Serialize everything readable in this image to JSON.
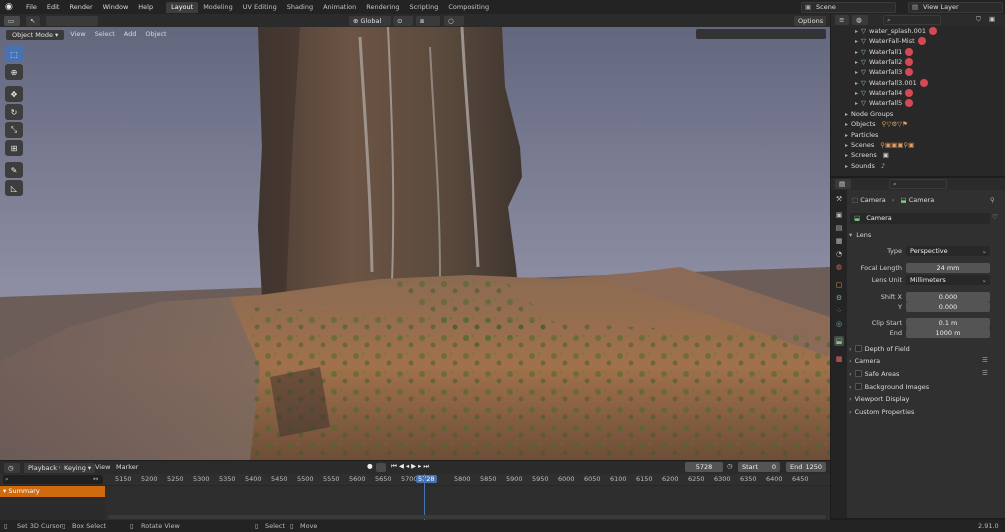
{
  "topbar": {
    "menus": [
      "File",
      "Edit",
      "Render",
      "Window",
      "Help"
    ],
    "workspaces": [
      "Layout",
      "Modeling",
      "UV Editing",
      "Shading",
      "Animation",
      "Rendering",
      "Scripting",
      "Compositing"
    ],
    "active_workspace": "Layout",
    "scene": "Scene",
    "view_layer": "View Layer"
  },
  "viewport_header": {
    "mode": "Object Mode",
    "menus": [
      "View",
      "Select",
      "Add",
      "Object"
    ],
    "orientation": "Global",
    "options": "Options"
  },
  "outliner": {
    "items": [
      {
        "name": "water_splash.001",
        "indent": 1
      },
      {
        "name": "WaterFall-Mist",
        "indent": 1
      },
      {
        "name": "Waterfall1",
        "indent": 1
      },
      {
        "name": "Waterfall2",
        "indent": 1
      },
      {
        "name": "Waterfall3",
        "indent": 1
      },
      {
        "name": "Waterfall3.001",
        "indent": 1
      },
      {
        "name": "Waterfall4",
        "indent": 1
      },
      {
        "name": "Waterfall5",
        "indent": 1
      },
      {
        "name": "Node Groups",
        "indent": 0
      },
      {
        "name": "Objects",
        "indent": 0
      },
      {
        "name": "Particles",
        "indent": 0
      },
      {
        "name": "Scenes",
        "indent": 0
      },
      {
        "name": "Screens",
        "indent": 0
      },
      {
        "name": "Sounds",
        "indent": 0
      }
    ]
  },
  "properties": {
    "breadcrumb_object": "Camera",
    "breadcrumb_data": "Camera",
    "datablock_name": "Camera",
    "lens_panel": "Lens",
    "type_label": "Type",
    "type_value": "Perspective",
    "focal_label": "Focal Length",
    "focal_value": "24 mm",
    "unit_label": "Lens Unit",
    "unit_value": "Millimeters",
    "shiftx_label": "Shift X",
    "shiftx_value": "0.000",
    "y_label": "Y",
    "y_value": "0.000",
    "clipstart_label": "Clip Start",
    "clipstart_value": "0.1 m",
    "end_label": "End",
    "end_value": "1000 m",
    "panels": [
      {
        "label": "Depth of Field",
        "checkbox": true
      },
      {
        "label": "Camera",
        "checkbox": false
      },
      {
        "label": "Safe Areas",
        "checkbox": true
      },
      {
        "label": "Background Images",
        "checkbox": true
      },
      {
        "label": "Viewport Display",
        "checkbox": false
      },
      {
        "label": "Custom Properties",
        "checkbox": false
      }
    ]
  },
  "timeline": {
    "menus": [
      "Playback",
      "Keying",
      "View",
      "Marker"
    ],
    "current_frame": "5728",
    "start_label": "Start",
    "start_value": "0",
    "end_label": "End",
    "end_value": "1250",
    "summary": "Summary",
    "ruler": [
      "5150",
      "5200",
      "5250",
      "5300",
      "5350",
      "5400",
      "5450",
      "5500",
      "5550",
      "5600",
      "5650",
      "5700",
      "5728",
      "5800",
      "5850",
      "5900",
      "5950",
      "6000",
      "6050",
      "6100",
      "6150",
      "6200",
      "6250",
      "6300",
      "6350",
      "6400",
      "6450"
    ]
  },
  "statusbar": {
    "items": [
      "Set 3D Cursor",
      "Box Select",
      "Rotate View",
      "Select",
      "Move"
    ],
    "version": "2.91.0"
  },
  "colors": {
    "accent": "#4772b3",
    "summary": "#d06a0e",
    "playhead": "#4772b3"
  }
}
